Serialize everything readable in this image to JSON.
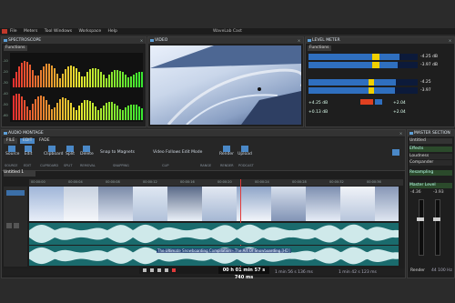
{
  "app": {
    "title": "WaveLab Cast",
    "menu": [
      "File",
      "Meters",
      "Tool Windows",
      "Workspace",
      "Help"
    ]
  },
  "spectroscope": {
    "title": "SPECTROSCOPE",
    "tab": "Functions",
    "y_labels": [
      "-10",
      "-20",
      "-30",
      "-40",
      "-50",
      "-60"
    ]
  },
  "video": {
    "title": "VIDEO"
  },
  "level_meter": {
    "title": "LEVEL METER",
    "tab": "Functions",
    "readouts": [
      "-4.25 dB",
      "-3.97 dB",
      "-4.25",
      "-3.97"
    ],
    "footer": [
      "+4.25 dB",
      "+2.04",
      "+0.13 dB",
      "+2.04"
    ]
  },
  "montage": {
    "title": "AUDIO MONTAGE",
    "tabs": [
      "FILE",
      "EDIT",
      "FADE"
    ],
    "tools": [
      "Source",
      "Edit",
      "Clipboard",
      "Split",
      "Delete",
      "Snap to Magnets",
      "Video Follows Edit Mode",
      "Render",
      "Upload"
    ],
    "groups": [
      "SOURCE",
      "EDIT",
      "CLIPBOARD",
      "SPLIT",
      "REMOVAL",
      "SNAPPING",
      "CLIP",
      "RANGE",
      "RENDER",
      "PODCAST"
    ],
    "track_tab": "Untitled 1",
    "ruler": [
      "00:00:00",
      "00:00:04",
      "00:00:08",
      "00:00:12",
      "00:00:16",
      "00:00:20",
      "00:00:24",
      "00:00:28",
      "00:00:32",
      "00:00:36"
    ],
    "clip_name": "The Ultimate Snowboarding Compilation - The Art Of Snowboarding [HD]",
    "status": [
      "1 min 56 s 136 ms",
      "00 h 01 min 57 s 740 ms",
      "1 min 42 s 123 ms"
    ],
    "timecode": "00 h 01 min 57 s 740 ms"
  },
  "master": {
    "title": "MASTER SECTION",
    "preset": "Untitled",
    "sections": [
      "Effects",
      "Loudness",
      "Compander",
      "Resampling",
      "Master Level"
    ],
    "readouts": [
      "-4.36",
      "-3.93"
    ],
    "render": "Render",
    "sample_rate": "44 100 Hz"
  },
  "colors": {
    "accent": "#4a88c7",
    "wave": "#1a6b6d",
    "meter_yellow": "#f0d000",
    "meter_red": "#e04020"
  }
}
